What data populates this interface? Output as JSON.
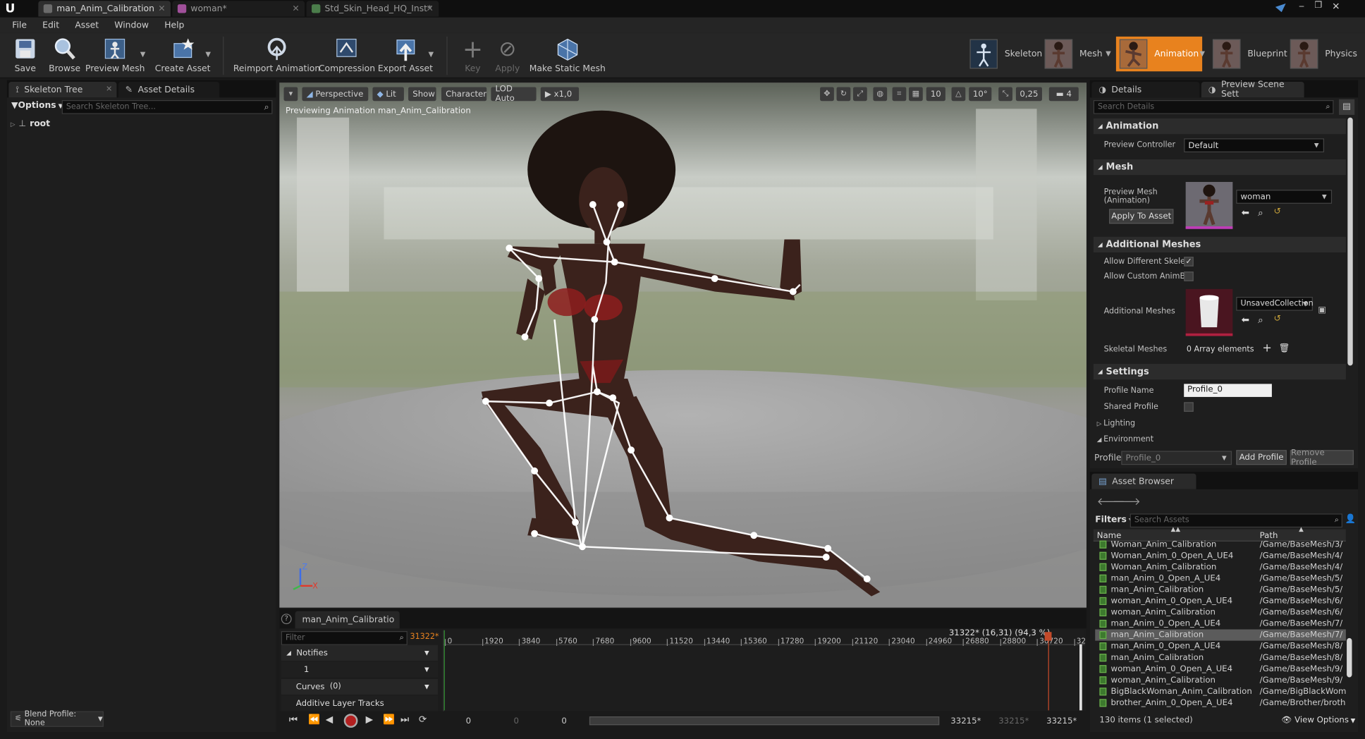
{
  "titlebar": {
    "tabs": [
      "man_Anim_Calibration",
      "woman*",
      "Std_Skin_Head_HQ_Inst*"
    ]
  },
  "menu": [
    "File",
    "Edit",
    "Asset",
    "Window",
    "Help"
  ],
  "toolbar": {
    "save": "Save",
    "browse": "Browse",
    "preview_mesh": "Preview Mesh",
    "create_asset": "Create Asset",
    "reimport": "Reimport Animation",
    "compression": "Compression",
    "export": "Export Asset",
    "key": "Key",
    "apply": "Apply",
    "make_static": "Make Static Mesh"
  },
  "modes": {
    "skeleton": "Skeleton",
    "mesh": "Mesh",
    "animation": "Animation",
    "blueprint": "Blueprint",
    "physics": "Physics"
  },
  "left_panel": {
    "tab_skeleton_tree": "Skeleton Tree",
    "tab_asset_details": "Asset Details",
    "options": "Options",
    "search_placeholder": "Search Skeleton Tree...",
    "root": "root",
    "blend_profile": "Blend Profile: None"
  },
  "viewport": {
    "perspective": "Perspective",
    "lit": "Lit",
    "show": "Show",
    "character": "Character",
    "lod": "LOD Auto",
    "speed": "x1,0",
    "grid": "10",
    "angle": "10°",
    "scale": "0,25",
    "cam_speed": "4",
    "status": "Previewing Animation man_Anim_Calibration",
    "axis_z": "Z",
    "axis_x": "X"
  },
  "details": {
    "tab_details": "Details",
    "tab_preview_scene": "Preview Scene Sett",
    "search_placeholder": "Search Details",
    "animation_section": "Animation",
    "preview_controller_label": "Preview Controller",
    "preview_controller_value": "Default",
    "mesh_section": "Mesh",
    "preview_mesh_label": "Preview Mesh (Animation)",
    "preview_mesh_value": "woman",
    "apply_to_asset": "Apply To Asset",
    "additional_meshes_section": "Additional Meshes",
    "allow_different": "Allow Different Skelet",
    "allow_custom": "Allow Custom AnimBl",
    "additional_meshes_label": "Additional Meshes",
    "additional_meshes_value": "UnsavedCollection",
    "skeletal_meshes_label": "Skeletal Meshes",
    "skeletal_meshes_value": "0 Array elements",
    "settings_section": "Settings",
    "profile_name_label": "Profile Name",
    "profile_name_value": "Profile_0",
    "shared_profile_label": "Shared Profile",
    "lighting": "Lighting",
    "environment": "Environment",
    "profile_label": "Profile",
    "profile_value": "Profile_0",
    "add_profile": "Add Profile",
    "remove_profile": "Remove Profile"
  },
  "asset_browser": {
    "tab": "Asset Browser",
    "filters": "Filters",
    "search_placeholder": "Search Assets",
    "col_name": "Name",
    "col_path": "Path",
    "rows": [
      {
        "name": "Woman_Anim_Calibration",
        "path": "/Game/BaseMesh/3/"
      },
      {
        "name": "Woman_Anim_0_Open_A_UE4",
        "path": "/Game/BaseMesh/4/"
      },
      {
        "name": "Woman_Anim_Calibration",
        "path": "/Game/BaseMesh/4/"
      },
      {
        "name": "man_Anim_0_Open_A_UE4",
        "path": "/Game/BaseMesh/5/"
      },
      {
        "name": "man_Anim_Calibration",
        "path": "/Game/BaseMesh/5/"
      },
      {
        "name": "woman_Anim_0_Open_A_UE4",
        "path": "/Game/BaseMesh/6/"
      },
      {
        "name": "woman_Anim_Calibration",
        "path": "/Game/BaseMesh/6/"
      },
      {
        "name": "man_Anim_0_Open_A_UE4",
        "path": "/Game/BaseMesh/7/"
      },
      {
        "name": "man_Anim_Calibration",
        "path": "/Game/BaseMesh/7/"
      },
      {
        "name": "man_Anim_0_Open_A_UE4",
        "path": "/Game/BaseMesh/8/"
      },
      {
        "name": "man_Anim_Calibration",
        "path": "/Game/BaseMesh/8/"
      },
      {
        "name": "woman_Anim_0_Open_A_UE4",
        "path": "/Game/BaseMesh/9/"
      },
      {
        "name": "woman_Anim_Calibration",
        "path": "/Game/BaseMesh/9/"
      },
      {
        "name": "BigBlackWoman_Anim_Calibration",
        "path": "/Game/BigBlackWom"
      },
      {
        "name": "brother_Anim_0_Open_A_UE4",
        "path": "/Game/Brother/broth"
      }
    ],
    "selected_index": 8,
    "count": "130 items (1 selected)",
    "view_options": "View Options"
  },
  "timeline": {
    "tab": "man_Anim_Calibratio",
    "filter_placeholder": "Filter",
    "frame_orange": "31322*",
    "notifies": "Notifies",
    "notify_track": "1",
    "curves": "Curves",
    "curves_count": "(0)",
    "additive": "Additive Layer Tracks",
    "playhead_info": "31322* (16,31) (94,3 %)",
    "ticks": [
      "0",
      "1920",
      "3840",
      "5760",
      "7680",
      "9600",
      "11520",
      "13440",
      "15360",
      "17280",
      "19200",
      "21120",
      "23040",
      "24960",
      "26880",
      "28800",
      "30720",
      "32"
    ],
    "start_a": "0",
    "start_b": "0",
    "start_c": "0",
    "end_a": "33215*",
    "end_b": "33215*",
    "end_c": "33215*"
  },
  "colors": {
    "accent_orange": "#e8821e",
    "selection": "#5b5b5b",
    "background": "#1a1a1a"
  }
}
